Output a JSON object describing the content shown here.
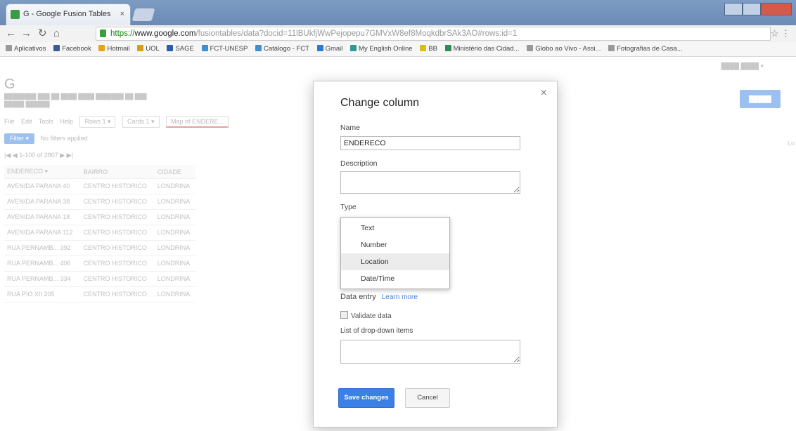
{
  "browser": {
    "tab_title": "G - Google Fusion Tables",
    "tab_close": "×",
    "url_https": "https://",
    "url_domain": "www.google.com",
    "url_rest": "/fusiontables/data?docid=11lBUkfjWwPejopepu7GMVxW8ef8MoqkdbrSAk3AO#rows:id=1",
    "bookmarks": [
      "Aplicativos",
      "Facebook",
      "Hotmail",
      "UOL",
      "SAGE",
      "FCT-UNESP",
      "Catálogo - FCT",
      "Gmail",
      "My English Online",
      "BB",
      "Ministério das Cidad...",
      "Globo ao Vivo - Assi...",
      "Fotografias de Casa..."
    ]
  },
  "page": {
    "logo": "G",
    "menu": [
      "File",
      "Edit",
      "Tools",
      "Help"
    ],
    "tabs": [
      "Rows 1 ▾",
      "Cards 1 ▾",
      "Map of ENDERE..."
    ],
    "filter_label": "Filter ▾",
    "no_filters": "No filters applied",
    "pager": "1-100 of 2807",
    "columns": [
      "ENDERECO ▾",
      "BAIRRO",
      "CIDADE"
    ],
    "rows": [
      [
        "AVENIDA PARANA 40",
        "CENTRO HISTORICO",
        "LONDRINA"
      ],
      [
        "AVENIDA PARANA 38",
        "CENTRO HISTORICO",
        "LONDRINA"
      ],
      [
        "AVENIDA PARANA 18",
        "CENTRO HISTORICO",
        "LONDRINA"
      ],
      [
        "AVENIDA PARANA 112",
        "CENTRO HISTORICO",
        "LONDRINA"
      ],
      [
        "RUA PERNAMB... 392",
        "CENTRO HISTORICO",
        "LONDRINA"
      ],
      [
        "RUA PERNAMB... 406",
        "CENTRO HISTORICO",
        "LONDRINA"
      ],
      [
        "RUA PERNAMB... 334",
        "CENTRO HISTORICO",
        "LONDRINA"
      ],
      [
        "RUA PIO XII 205",
        "CENTRO HISTORICO",
        "LONDRINA"
      ]
    ]
  },
  "dialog": {
    "title": "Change column",
    "close": "×",
    "name_label": "Name",
    "name_value": "ENDERECO",
    "description_label": "Description",
    "type_label": "Type",
    "type_options": [
      "Text",
      "Number",
      "Location",
      "Date/Time"
    ],
    "data_entry_label": "Data entry",
    "learn_more": "Learn more",
    "validate_label": "Validate data",
    "dropdown_items_label": "List of drop-down items",
    "save_button": "Save changes",
    "cancel_button": "Cancel"
  }
}
